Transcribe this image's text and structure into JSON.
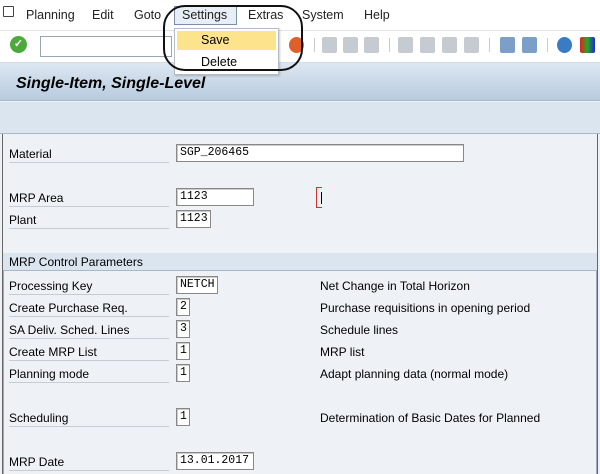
{
  "menubar": {
    "items": [
      "Planning",
      "Edit",
      "Goto",
      "Settings",
      "Extras",
      "System",
      "Help"
    ]
  },
  "settings_menu": {
    "items": [
      "Save",
      "Delete"
    ],
    "highlighted": "Save"
  },
  "title": "Single-Item, Single-Level",
  "header_fields": {
    "material": {
      "label": "Material",
      "value": "SGP_206465"
    },
    "mrp_area": {
      "label": "MRP Area",
      "value": "1123"
    },
    "plant": {
      "label": "Plant",
      "value": "1123"
    }
  },
  "group": {
    "title": "MRP Control Parameters",
    "rows": [
      {
        "label": "Processing Key",
        "value": "NETCH",
        "desc": "Net Change in Total Horizon"
      },
      {
        "label": "Create Purchase Req.",
        "value": "2",
        "desc": "Purchase requisitions in opening period"
      },
      {
        "label": "SA Deliv. Sched. Lines",
        "value": "3",
        "desc": "Schedule lines"
      },
      {
        "label": "Create MRP List",
        "value": "1",
        "desc": "MRP list"
      },
      {
        "label": "Planning mode",
        "value": "1",
        "desc": "Adapt planning data (normal mode)"
      },
      {
        "label": "Scheduling",
        "value": "1",
        "desc": "Determination of Basic Dates for Planned"
      },
      {
        "label": "MRP Date",
        "value": "13.01.2017",
        "desc": ""
      }
    ]
  }
}
